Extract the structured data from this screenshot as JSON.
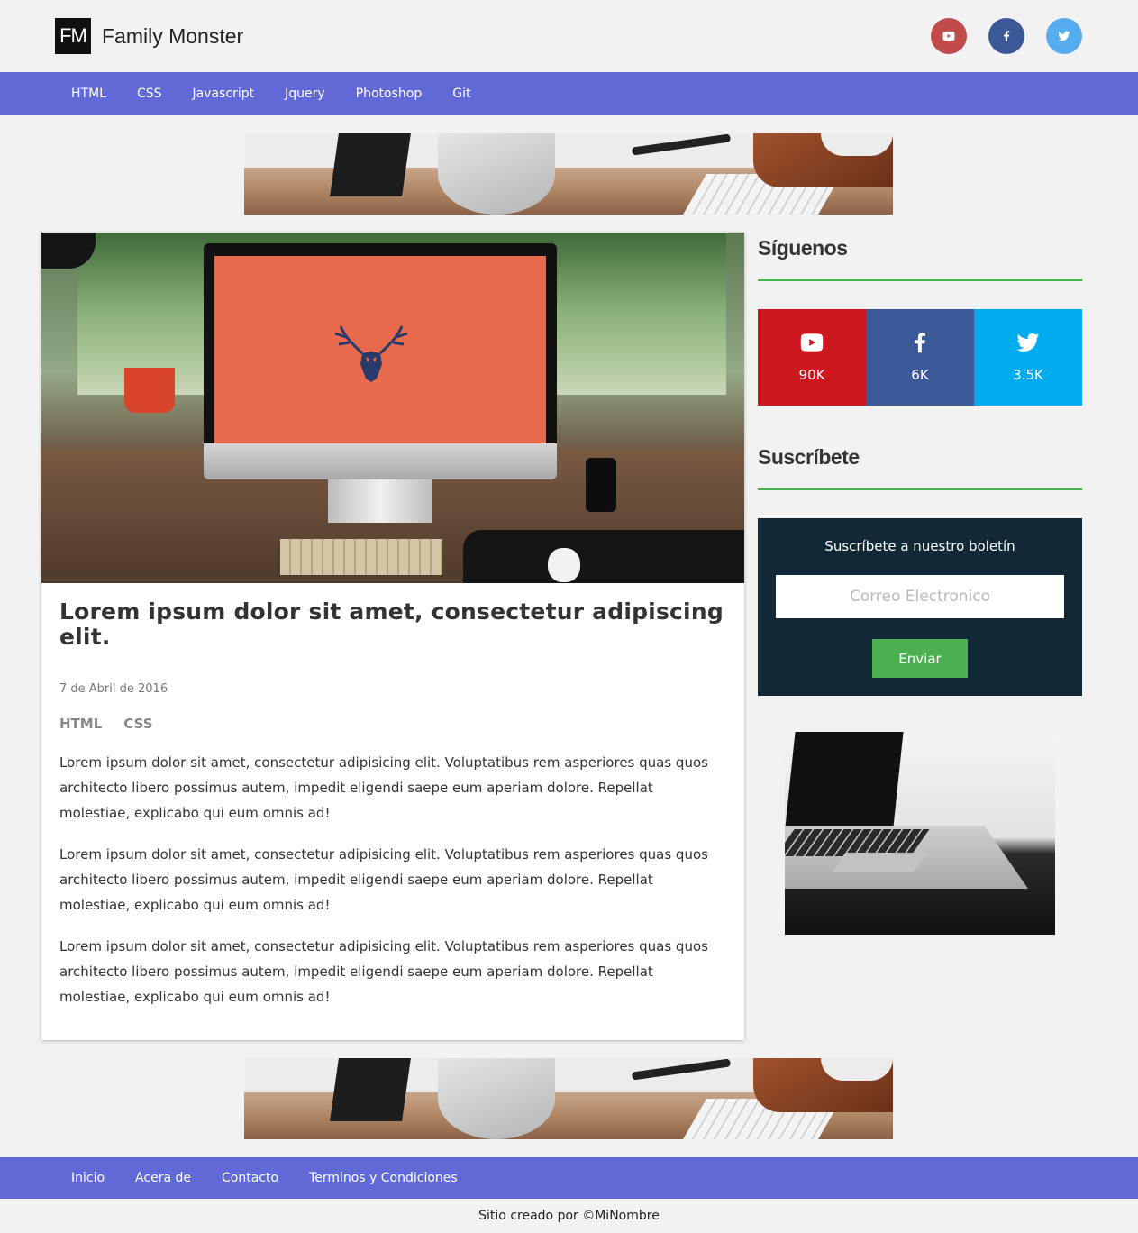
{
  "brand": {
    "logo_mark": "FM",
    "name": "Family Monster"
  },
  "header_social": [
    {
      "icon": "youtube-icon",
      "color": "#c14a4a"
    },
    {
      "icon": "facebook-icon",
      "color": "#3b5998"
    },
    {
      "icon": "twitter-icon",
      "color": "#55acee"
    }
  ],
  "nav": [
    "HTML",
    "CSS",
    "Javascript",
    "Jquery",
    "Photoshop",
    "Git"
  ],
  "article": {
    "title": "Lorem ipsum dolor sit amet, consectetur adipiscing elit.",
    "date": "7 de Abril de 2016",
    "tags": [
      "HTML",
      "CSS"
    ],
    "paragraphs": [
      "Lorem ipsum dolor sit amet, consectetur adipisicing elit. Voluptatibus rem asperiores quas quos architecto libero possimus autem, impedit eligendi saepe eum aperiam dolore. Repellat molestiae, explicabo qui eum omnis ad!",
      "Lorem ipsum dolor sit amet, consectetur adipisicing elit. Voluptatibus rem asperiores quas quos architecto libero possimus autem, impedit eligendi saepe eum aperiam dolore. Repellat molestiae, explicabo qui eum omnis ad!",
      "Lorem ipsum dolor sit amet, consectetur adipisicing elit. Voluptatibus rem asperiores quas quos architecto libero possimus autem, impedit eligendi saepe eum aperiam dolore. Repellat molestiae, explicabo qui eum omnis ad!"
    ]
  },
  "sidebar": {
    "follow_title": "Síguenos",
    "follow": [
      {
        "icon": "youtube-icon",
        "count": "90K",
        "color": "#cc181e"
      },
      {
        "icon": "facebook-icon",
        "count": "6K",
        "color": "#3b5998"
      },
      {
        "icon": "twitter-icon",
        "count": "3.5K",
        "color": "#00acee"
      }
    ],
    "subscribe_title": "Suscríbete",
    "newsletter": {
      "title": "Suscríbete a nuestro boletín",
      "placeholder": "Correo Electronico",
      "value": "",
      "button": "Enviar"
    },
    "accent_color": "#4caf50"
  },
  "footer": {
    "nav": [
      "Inicio",
      "Acera de",
      "Contacto",
      "Terminos y Condiciones"
    ],
    "credits": "Sitio creado por ©MiNombre"
  },
  "colors": {
    "nav_bg": "#6069d6",
    "newsletter_bg": "#122836",
    "page_bg": "#f2f2f2"
  }
}
